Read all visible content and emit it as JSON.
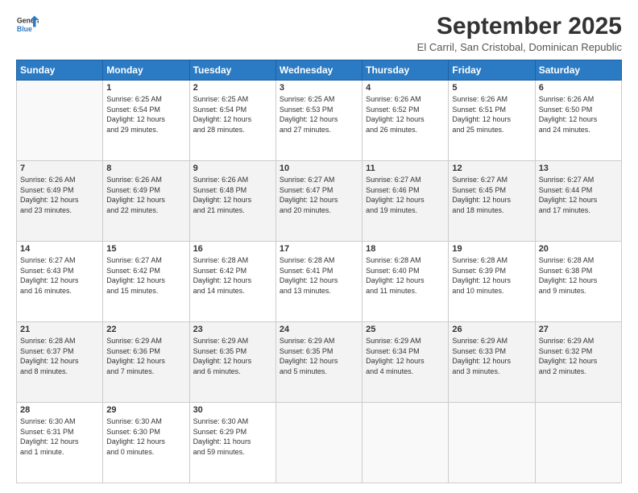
{
  "logo": {
    "line1": "General",
    "line2": "Blue"
  },
  "header": {
    "month": "September 2025",
    "location": "El Carril, San Cristobal, Dominican Republic"
  },
  "weekdays": [
    "Sunday",
    "Monday",
    "Tuesday",
    "Wednesday",
    "Thursday",
    "Friday",
    "Saturday"
  ],
  "weeks": [
    [
      {
        "day": "",
        "info": ""
      },
      {
        "day": "1",
        "info": "Sunrise: 6:25 AM\nSunset: 6:54 PM\nDaylight: 12 hours\nand 29 minutes."
      },
      {
        "day": "2",
        "info": "Sunrise: 6:25 AM\nSunset: 6:54 PM\nDaylight: 12 hours\nand 28 minutes."
      },
      {
        "day": "3",
        "info": "Sunrise: 6:25 AM\nSunset: 6:53 PM\nDaylight: 12 hours\nand 27 minutes."
      },
      {
        "day": "4",
        "info": "Sunrise: 6:26 AM\nSunset: 6:52 PM\nDaylight: 12 hours\nand 26 minutes."
      },
      {
        "day": "5",
        "info": "Sunrise: 6:26 AM\nSunset: 6:51 PM\nDaylight: 12 hours\nand 25 minutes."
      },
      {
        "day": "6",
        "info": "Sunrise: 6:26 AM\nSunset: 6:50 PM\nDaylight: 12 hours\nand 24 minutes."
      }
    ],
    [
      {
        "day": "7",
        "info": "Sunrise: 6:26 AM\nSunset: 6:49 PM\nDaylight: 12 hours\nand 23 minutes."
      },
      {
        "day": "8",
        "info": "Sunrise: 6:26 AM\nSunset: 6:49 PM\nDaylight: 12 hours\nand 22 minutes."
      },
      {
        "day": "9",
        "info": "Sunrise: 6:26 AM\nSunset: 6:48 PM\nDaylight: 12 hours\nand 21 minutes."
      },
      {
        "day": "10",
        "info": "Sunrise: 6:27 AM\nSunset: 6:47 PM\nDaylight: 12 hours\nand 20 minutes."
      },
      {
        "day": "11",
        "info": "Sunrise: 6:27 AM\nSunset: 6:46 PM\nDaylight: 12 hours\nand 19 minutes."
      },
      {
        "day": "12",
        "info": "Sunrise: 6:27 AM\nSunset: 6:45 PM\nDaylight: 12 hours\nand 18 minutes."
      },
      {
        "day": "13",
        "info": "Sunrise: 6:27 AM\nSunset: 6:44 PM\nDaylight: 12 hours\nand 17 minutes."
      }
    ],
    [
      {
        "day": "14",
        "info": "Sunrise: 6:27 AM\nSunset: 6:43 PM\nDaylight: 12 hours\nand 16 minutes."
      },
      {
        "day": "15",
        "info": "Sunrise: 6:27 AM\nSunset: 6:42 PM\nDaylight: 12 hours\nand 15 minutes."
      },
      {
        "day": "16",
        "info": "Sunrise: 6:28 AM\nSunset: 6:42 PM\nDaylight: 12 hours\nand 14 minutes."
      },
      {
        "day": "17",
        "info": "Sunrise: 6:28 AM\nSunset: 6:41 PM\nDaylight: 12 hours\nand 13 minutes."
      },
      {
        "day": "18",
        "info": "Sunrise: 6:28 AM\nSunset: 6:40 PM\nDaylight: 12 hours\nand 11 minutes."
      },
      {
        "day": "19",
        "info": "Sunrise: 6:28 AM\nSunset: 6:39 PM\nDaylight: 12 hours\nand 10 minutes."
      },
      {
        "day": "20",
        "info": "Sunrise: 6:28 AM\nSunset: 6:38 PM\nDaylight: 12 hours\nand 9 minutes."
      }
    ],
    [
      {
        "day": "21",
        "info": "Sunrise: 6:28 AM\nSunset: 6:37 PM\nDaylight: 12 hours\nand 8 minutes."
      },
      {
        "day": "22",
        "info": "Sunrise: 6:29 AM\nSunset: 6:36 PM\nDaylight: 12 hours\nand 7 minutes."
      },
      {
        "day": "23",
        "info": "Sunrise: 6:29 AM\nSunset: 6:35 PM\nDaylight: 12 hours\nand 6 minutes."
      },
      {
        "day": "24",
        "info": "Sunrise: 6:29 AM\nSunset: 6:35 PM\nDaylight: 12 hours\nand 5 minutes."
      },
      {
        "day": "25",
        "info": "Sunrise: 6:29 AM\nSunset: 6:34 PM\nDaylight: 12 hours\nand 4 minutes."
      },
      {
        "day": "26",
        "info": "Sunrise: 6:29 AM\nSunset: 6:33 PM\nDaylight: 12 hours\nand 3 minutes."
      },
      {
        "day": "27",
        "info": "Sunrise: 6:29 AM\nSunset: 6:32 PM\nDaylight: 12 hours\nand 2 minutes."
      }
    ],
    [
      {
        "day": "28",
        "info": "Sunrise: 6:30 AM\nSunset: 6:31 PM\nDaylight: 12 hours\nand 1 minute."
      },
      {
        "day": "29",
        "info": "Sunrise: 6:30 AM\nSunset: 6:30 PM\nDaylight: 12 hours\nand 0 minutes."
      },
      {
        "day": "30",
        "info": "Sunrise: 6:30 AM\nSunset: 6:29 PM\nDaylight: 11 hours\nand 59 minutes."
      },
      {
        "day": "",
        "info": ""
      },
      {
        "day": "",
        "info": ""
      },
      {
        "day": "",
        "info": ""
      },
      {
        "day": "",
        "info": ""
      }
    ]
  ]
}
